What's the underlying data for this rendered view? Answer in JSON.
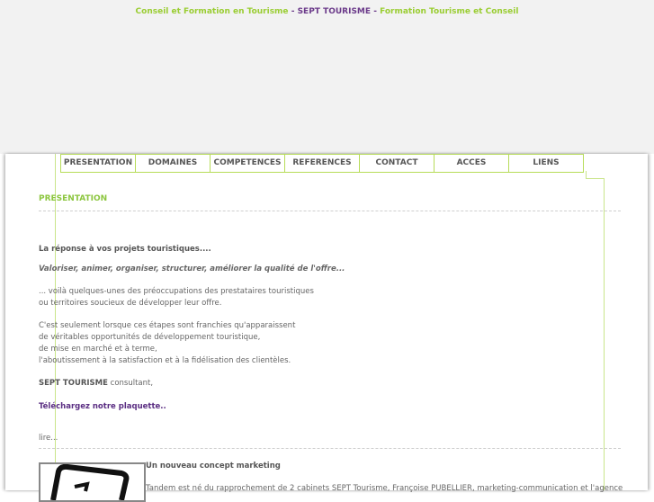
{
  "header": {
    "title_left": "Conseil et Formation en Tourisme",
    "sep1": "-",
    "brand": "SEPT TOURISME",
    "sep2": "-",
    "title_right": "Formation Tourisme et Conseil"
  },
  "nav": {
    "items": [
      {
        "label": "PRESENTATION"
      },
      {
        "label": "DOMAINES"
      },
      {
        "label": "COMPETENCES"
      },
      {
        "label": "REFERENCES"
      },
      {
        "label": "CONTACT"
      },
      {
        "label": "ACCES"
      },
      {
        "label": "LIENS"
      }
    ]
  },
  "main": {
    "section_title": "PRESENTATION",
    "heading": "La réponse à vos projets touristiques....",
    "tagline": "Valoriser, animer, organiser, structurer, améliorer la qualité de l'offre...",
    "para1_line1": "... voilà quelques-unes des préoccupations des prestataires touristiques",
    "para1_line2": "ou territoires soucieux de développer leur offre.",
    "para2_line1": "C'est seulement lorsque ces étapes sont franchies qu'apparaissent",
    "para2_line2": "de véritables opportunités de développement touristique,",
    "para2_line3": "de mise en marché et à terme,",
    "para2_line4": "l'aboutissement à la satisfaction et à la fidélisation des clientèles.",
    "consultant_brand": "SEPT TOURISME",
    "consultant_suffix": " consultant,",
    "download_link": "Téléchargez notre plaquette..",
    "read_more": "lire...",
    "marketing_title": "Un nouveau concept marketing",
    "marketing_text": "Tandem est né du rapprochement de 2 cabinets SEPT Tourisme, Françoise PUBELLIER, marketing-communication et l'agence"
  },
  "colors": {
    "accent_green": "#8cc63f",
    "brand_purple": "#5a2d82",
    "line_green": "#c9e58a"
  }
}
